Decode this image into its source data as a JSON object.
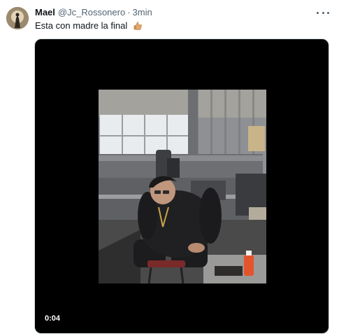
{
  "tweet": {
    "author": {
      "display_name": "Mael",
      "handle": "@Jc_Rossonero",
      "separator": "·",
      "time": "3min"
    },
    "text": "Esta con madre la final",
    "emoji_icon": "thumbs-up-icon",
    "media": {
      "type": "video",
      "duration": "0:04",
      "background": "#000000"
    },
    "menu_icon": "more-options-icon"
  }
}
